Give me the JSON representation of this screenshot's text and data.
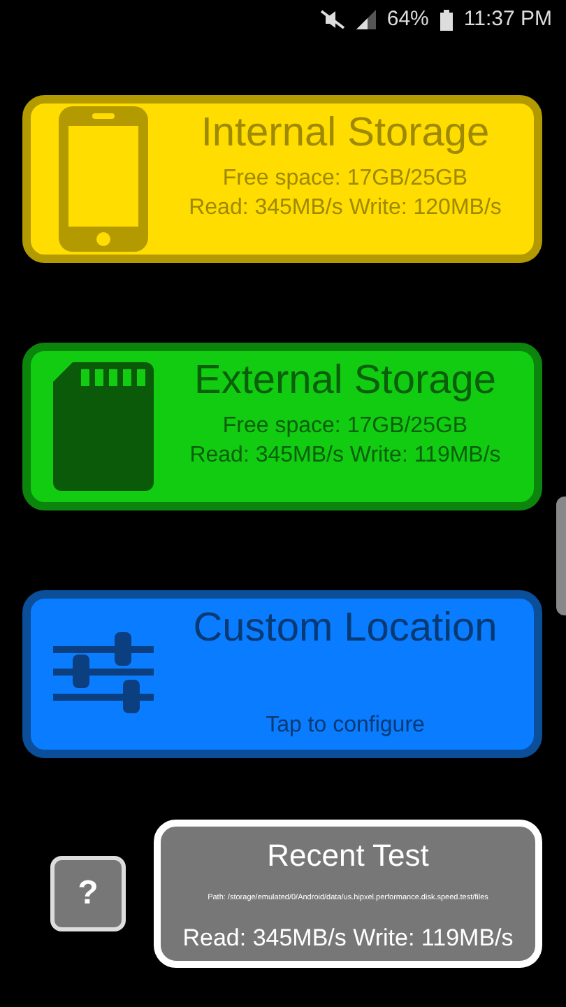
{
  "status_bar": {
    "battery": "64%",
    "time": "11:37 PM"
  },
  "storage_cards": [
    {
      "kind": "internal",
      "title": "Internal Storage",
      "lines": [
        "Free space: 17GB/25GB",
        "Read: 345MB/s Write: 120MB/s"
      ]
    },
    {
      "kind": "external",
      "title": "External Storage",
      "lines": [
        "Free space: 17GB/25GB",
        "Read: 345MB/s Write: 119MB/s"
      ]
    },
    {
      "kind": "custom",
      "title": "Custom Location",
      "lines": [
        "Tap to configure"
      ]
    }
  ],
  "help_button": {
    "label": "?"
  },
  "recent_test": {
    "title": "Recent Test",
    "path": "Path: /storage/emulated/0/Android/data/us.hipxel.performance.disk.speed.test/files",
    "result": "Read: 345MB/s Write: 119MB/s"
  }
}
